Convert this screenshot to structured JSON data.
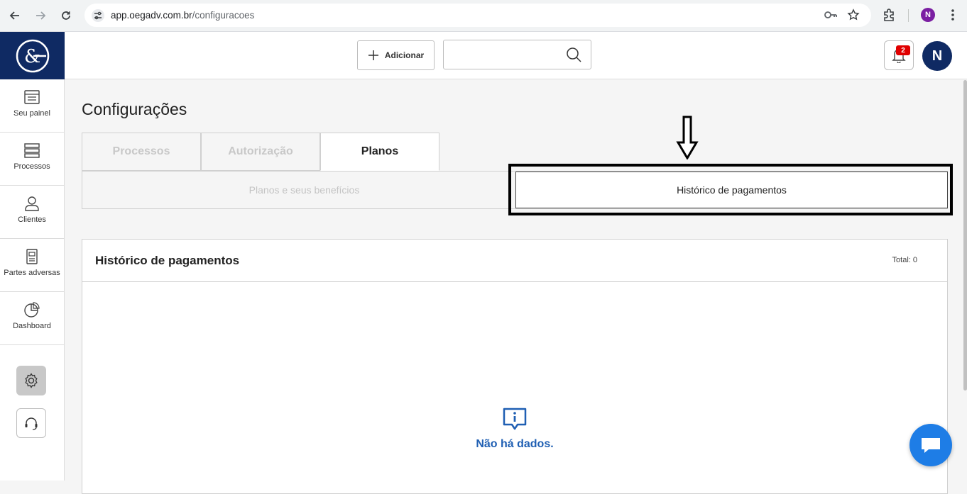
{
  "browser": {
    "url_host": "app.oegadv.com.br",
    "url_path": "/configuracoes",
    "profile_initial": "N"
  },
  "sidebar": {
    "items": [
      {
        "label": "Seu painel",
        "icon": "panel-icon"
      },
      {
        "label": "Processos",
        "icon": "list-icon"
      },
      {
        "label": "Clientes",
        "icon": "user-icon"
      },
      {
        "label": "Partes adversas",
        "icon": "document-icon"
      },
      {
        "label": "Dashboard",
        "icon": "pie-chart-icon"
      }
    ],
    "bottom_buttons": [
      "settings-icon",
      "headset-icon"
    ]
  },
  "topbar": {
    "add_label": "Adicionar",
    "search_placeholder": "",
    "notification_count": "2",
    "avatar_initial": "N"
  },
  "main": {
    "title": "Configurações",
    "tabs": [
      {
        "label": "Processos",
        "active": false
      },
      {
        "label": "Autorização",
        "active": false
      },
      {
        "label": "Planos",
        "active": true
      }
    ],
    "subtabs": [
      {
        "label": "Planos e seus benefícios",
        "active": false
      },
      {
        "label": "Histórico de pagamentos",
        "active": true
      }
    ],
    "card": {
      "title": "Histórico de pagamentos",
      "total": "Total: 0",
      "empty_message": "Não há dados."
    }
  },
  "colors": {
    "brand_navy": "#0f2a63",
    "link_blue": "#1f5fb3",
    "chat_blue": "#1e7de6",
    "badge_red": "#e00000"
  }
}
